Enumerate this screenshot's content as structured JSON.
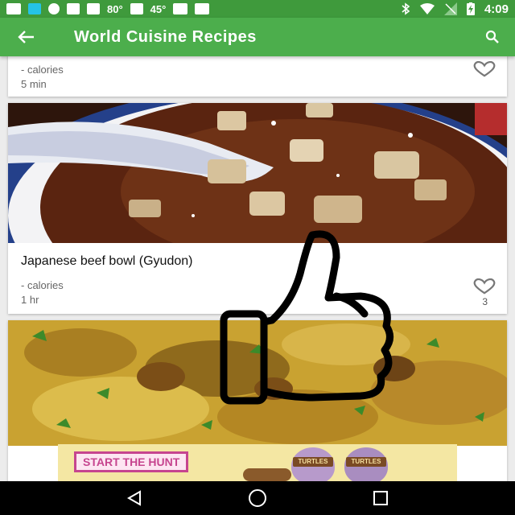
{
  "status_bar": {
    "temp_1": "80°",
    "temp_2": "45°",
    "time": "4:09"
  },
  "app_bar": {
    "title": "World Cuisine Recipes"
  },
  "recipes": [
    {
      "name": "",
      "calories": "- calories",
      "time": "5 min",
      "likes": ""
    },
    {
      "name": "Japanese beef bowl (Gyudon)",
      "calories": "- calories",
      "time": "1 hr",
      "likes": "3"
    },
    {
      "name": "",
      "calories": "",
      "time": "",
      "likes": ""
    }
  ],
  "ad": {
    "cta": "START THE HUNT",
    "brand": "TURTLES"
  },
  "colors": {
    "status_bar": "#3f9a3c",
    "app_bar": "#4cae4c",
    "ad_accent": "#c6458f"
  },
  "icons": {
    "back": "arrow-back-icon",
    "search": "search-icon",
    "favorite": "heart-outline-icon",
    "nav_back": "triangle-back-icon",
    "nav_home": "circle-home-icon",
    "nav_recents": "square-recents-icon",
    "overlay": "thumbs-up-icon"
  }
}
